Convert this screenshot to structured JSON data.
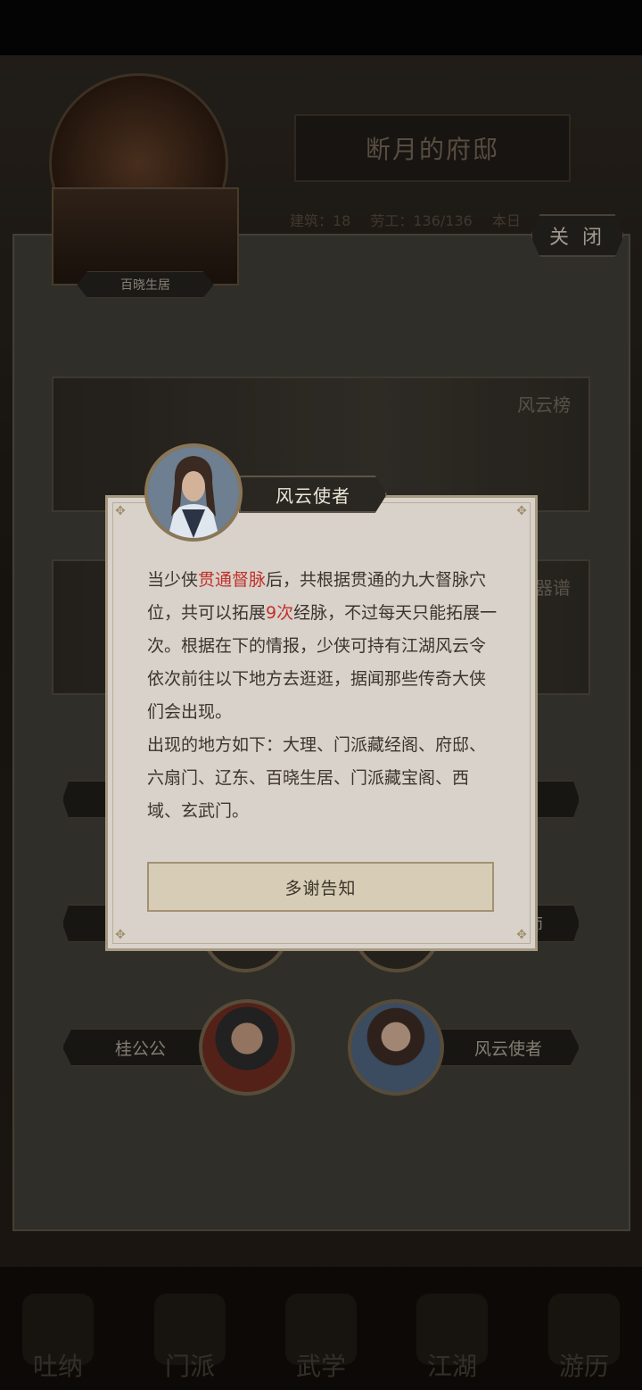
{
  "header": {
    "mansion_title": "断月的府邸",
    "stats": [
      "建筑：18",
      "劳工：136/136",
      "本日"
    ]
  },
  "close_label": "关 闭",
  "location_thumb_label": "百晓生居",
  "banners": [
    {
      "label": "风云榜"
    },
    {
      "label": "器谱"
    }
  ],
  "npcs": [
    {
      "label": "桂公公"
    },
    {
      "label": "风云使者"
    }
  ],
  "partial_labels": {
    "right_npc_row3": "师"
  },
  "bottom_tabs": [
    "吐纳",
    "门派",
    "武学",
    "江湖",
    "游历"
  ],
  "dialog": {
    "title": "风云使者",
    "text_before_1": "当少侠",
    "highlight_1": "贯通督脉",
    "text_after_1": "后，共根据贯通的九大督脉穴位，共可以拓展",
    "highlight_2": "9次",
    "text_after_2": "经脉，不过每天只能拓展一次。根据在下的情报，少侠可持有江湖风云令依次前往以下地方去逛逛，据闻那些传奇大侠们会出现。",
    "text_line_2": "出现的地方如下：大理、门派藏经阁、府邸、六扇门、辽东、百晓生居、门派藏宝阁、西域、玄武门。",
    "button_label": "多谢告知"
  },
  "colors": {
    "highlight": "#c0312b",
    "dialog_bg": "#d8d2ca"
  }
}
